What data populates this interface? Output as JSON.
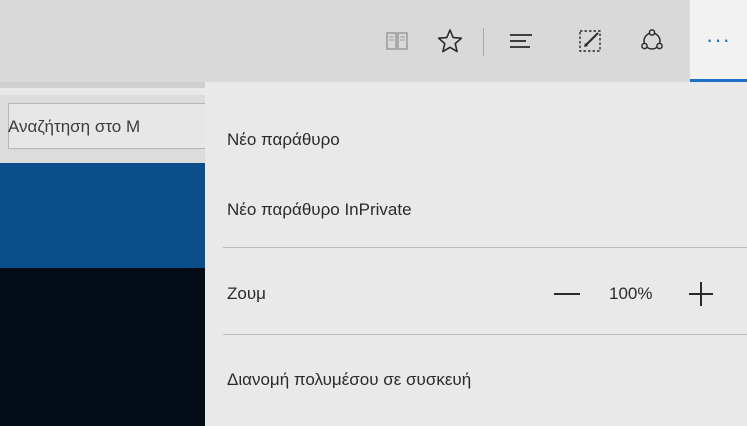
{
  "toolbar": {
    "icons": [
      "reading-view-icon",
      "favorite-star-icon",
      "hub-icon",
      "web-note-icon",
      "share-icon",
      "more-actions-icon"
    ],
    "more_label": "···",
    "accent_color": "#1e6fc6"
  },
  "page": {
    "search_placeholder": "Αναζήτηση στο Μ"
  },
  "menu": {
    "new_window": "Νέο παράθυρο",
    "new_inprivate_window": "Νέο παράθυρο InPrivate",
    "zoom_label": "Ζουμ",
    "zoom_value": "100%",
    "cast_media": "Διανομή πολυμέσου σε συσκευή"
  }
}
